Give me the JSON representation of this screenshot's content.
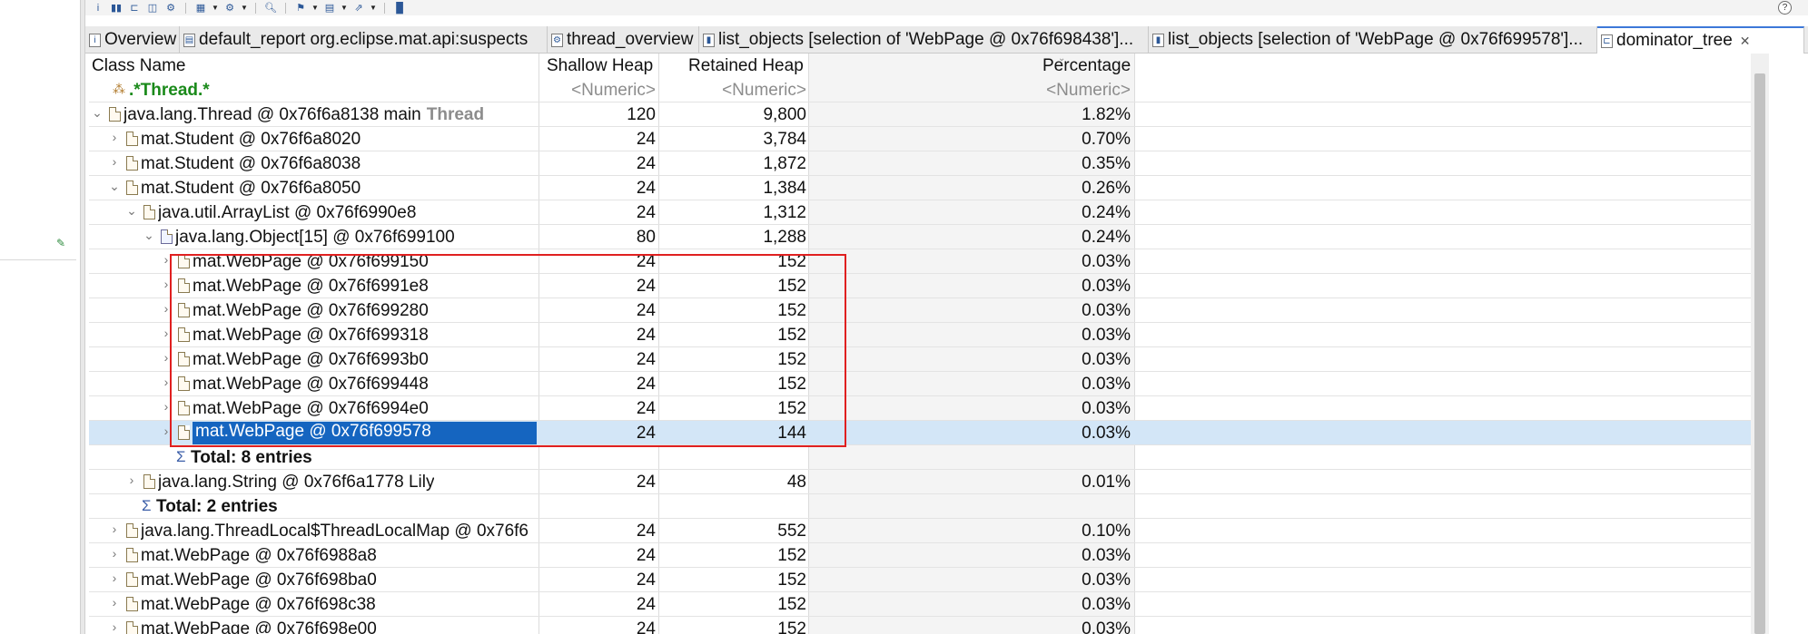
{
  "toolbar": {
    "icons": [
      "info-icon",
      "histogram-icon",
      "dominator-tree-icon",
      "oql-icon",
      "thread-icon",
      "query-browser-icon",
      "search-icon",
      "group-icon",
      "calculate-icon",
      "export-icon",
      "report-icon",
      "help-icon"
    ],
    "info_glyph": "i",
    "help_glyph": "?"
  },
  "tabs": [
    {
      "label": "Overview",
      "icon": "info-icon",
      "glyph": "i"
    },
    {
      "label": "default_report  org.eclipse.mat.api:suspects",
      "icon": "report-icon",
      "glyph": "▤"
    },
    {
      "label": "thread_overview",
      "icon": "thread-icon",
      "glyph": "⚙"
    },
    {
      "label": "list_objects  [selection of 'WebPage @ 0x76f698438']...",
      "icon": "list-icon",
      "glyph": "▮"
    },
    {
      "label": "list_objects  [selection of 'WebPage @ 0x76f699578']...",
      "icon": "list-icon",
      "glyph": "▮"
    },
    {
      "label": "dominator_tree",
      "icon": "dominator-tree-icon",
      "glyph": "⊏",
      "active": true,
      "close": "✕"
    }
  ],
  "columns": {
    "class_name": "Class Name",
    "shallow_heap": "Shallow Heap",
    "retained_heap": "Retained Heap",
    "percentage": "Percentage"
  },
  "filter_row": {
    "name": ".*Thread.*",
    "shallow": "<Numeric>",
    "retained": "<Numeric>",
    "percentage": "<Numeric>"
  },
  "rows": [
    {
      "name": "java.lang.Thread @ 0x76f6a8138  main",
      "suffix": "Thread",
      "shallow": "120",
      "retained": "9,800",
      "pct": "1.82%",
      "toggle": "⌄"
    },
    {
      "name": "mat.Student @ 0x76f6a8020",
      "shallow": "24",
      "retained": "3,784",
      "pct": "0.70%",
      "toggle": "›"
    },
    {
      "name": "mat.Student @ 0x76f6a8038",
      "shallow": "24",
      "retained": "1,872",
      "pct": "0.35%",
      "toggle": "›"
    },
    {
      "name": "mat.Student @ 0x76f6a8050",
      "shallow": "24",
      "retained": "1,384",
      "pct": "0.26%",
      "toggle": "⌄"
    },
    {
      "name": "java.util.ArrayList @ 0x76f6990e8",
      "shallow": "24",
      "retained": "1,312",
      "pct": "0.24%",
      "toggle": "⌄"
    },
    {
      "name": "java.lang.Object[15] @ 0x76f699100",
      "shallow": "80",
      "retained": "1,288",
      "pct": "0.24%",
      "toggle": "⌄"
    },
    {
      "name": "mat.WebPage @ 0x76f699150",
      "shallow": "24",
      "retained": "152",
      "pct": "0.03%",
      "toggle": "›"
    },
    {
      "name": "mat.WebPage @ 0x76f6991e8",
      "shallow": "24",
      "retained": "152",
      "pct": "0.03%",
      "toggle": "›"
    },
    {
      "name": "mat.WebPage @ 0x76f699280",
      "shallow": "24",
      "retained": "152",
      "pct": "0.03%",
      "toggle": "›"
    },
    {
      "name": "mat.WebPage @ 0x76f699318",
      "shallow": "24",
      "retained": "152",
      "pct": "0.03%",
      "toggle": "›"
    },
    {
      "name": "mat.WebPage @ 0x76f6993b0",
      "shallow": "24",
      "retained": "152",
      "pct": "0.03%",
      "toggle": "›"
    },
    {
      "name": "mat.WebPage @ 0x76f699448",
      "shallow": "24",
      "retained": "152",
      "pct": "0.03%",
      "toggle": "›"
    },
    {
      "name": "mat.WebPage @ 0x76f6994e0",
      "shallow": "24",
      "retained": "152",
      "pct": "0.03%",
      "toggle": "›"
    },
    {
      "name": "mat.WebPage @ 0x76f699578",
      "shallow": "24",
      "retained": "144",
      "pct": "0.03%",
      "toggle": "›",
      "selected": true
    },
    {
      "name": "Total: 8 entries",
      "total": true
    },
    {
      "name": "java.lang.String @ 0x76f6a1778  Lily",
      "shallow": "24",
      "retained": "48",
      "pct": "0.01%",
      "toggle": "›"
    },
    {
      "name": "Total: 2 entries",
      "total": true
    },
    {
      "name": "java.lang.ThreadLocal$ThreadLocalMap @ 0x76f6",
      "shallow": "24",
      "retained": "552",
      "pct": "0.10%",
      "toggle": "›"
    },
    {
      "name": "mat.WebPage @ 0x76f6988a8",
      "shallow": "24",
      "retained": "152",
      "pct": "0.03%",
      "toggle": "›"
    },
    {
      "name": "mat.WebPage @ 0x76f698ba0",
      "shallow": "24",
      "retained": "152",
      "pct": "0.03%",
      "toggle": "›"
    },
    {
      "name": "mat.WebPage @ 0x76f698c38",
      "shallow": "24",
      "retained": "152",
      "pct": "0.03%",
      "toggle": "›"
    },
    {
      "name": "mat.WebPage @ 0x76f698e00",
      "shallow": "24",
      "retained": "152",
      "pct": "0.03%",
      "toggle": "›"
    }
  ],
  "glyphs": {
    "sigma": "Σ",
    "filter": "⁂",
    "pin": "✎",
    "sort_caret": "⌄"
  },
  "colors": {
    "selection": "#1565c0",
    "selected_row": "#d3e6f7",
    "highlight_box": "#e02020",
    "regex_filter": "#1a8a1a",
    "active_tab": "#3c78d8"
  }
}
